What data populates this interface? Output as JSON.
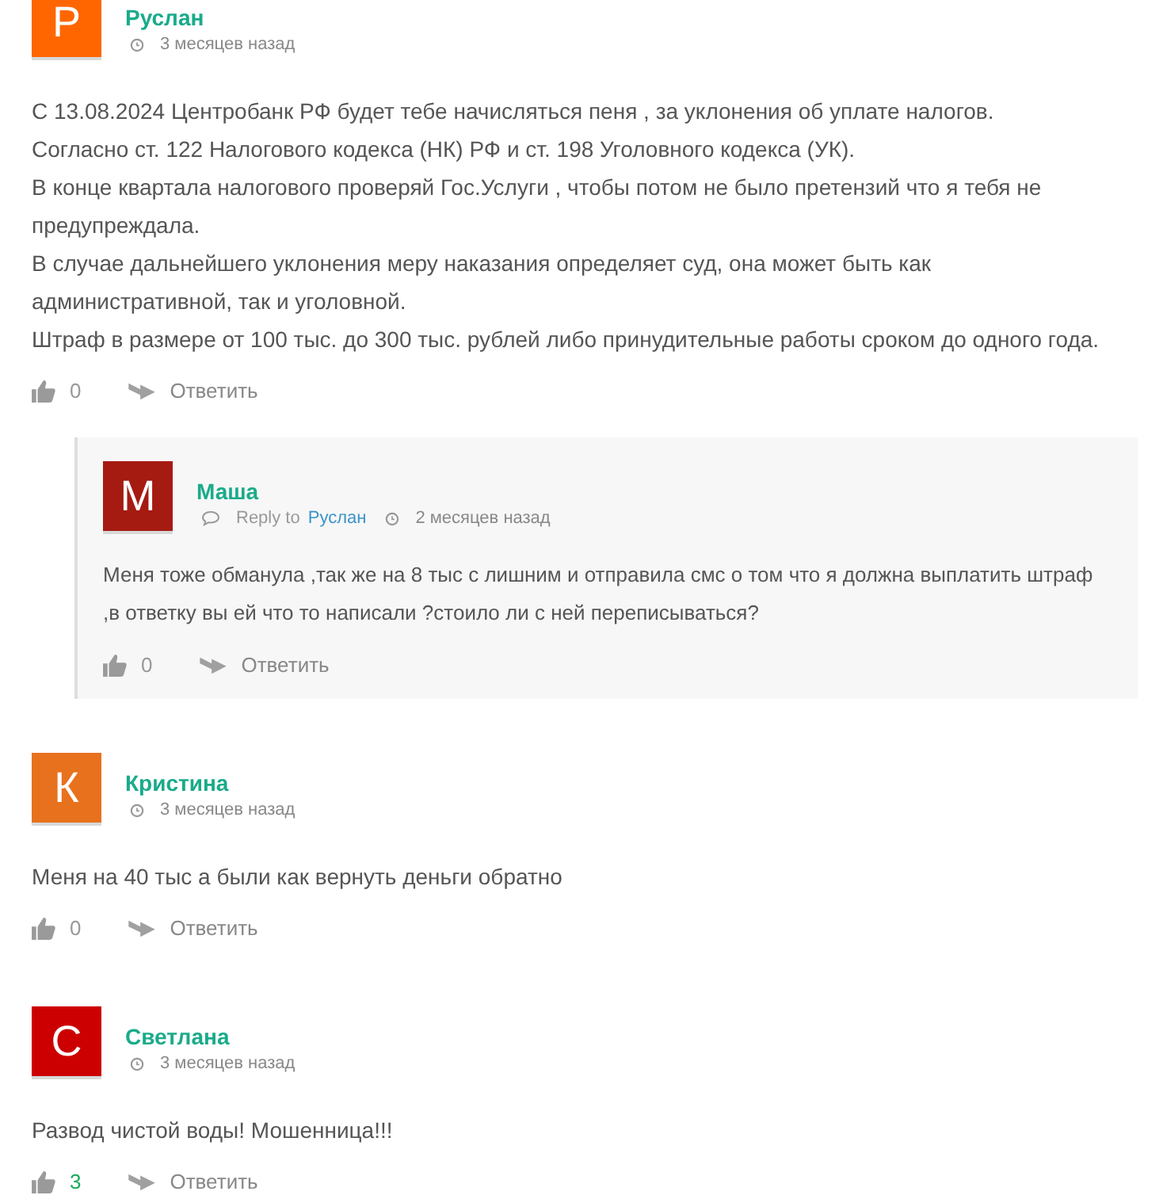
{
  "comments": [
    {
      "initial": "Р",
      "color": "#ff6600",
      "author": "Руслан",
      "time": "3 месяцев назад",
      "lines": [
        "С 13.08.2024 Центробанк РФ будет тебе начисляться пеня , за уклонения об уплате налогов.",
        "Согласно ст. 122 Налогового кодекса (НК) РФ и ст. 198 Уголовного кодекса (УК).",
        "В конце квартала налогового проверяй Гос.Услуги , чтобы потом не было претензий что я тебя не предупреждала.",
        "В случае дальнейшего уклонения меру наказания определяет суд, она может быть как административной, так и уголовной.",
        "Штраф в размере от 100 тыс. до 300 тыс. рублей либо принудительные работы сроком до одного года."
      ],
      "votes": "0",
      "votes_positive": false,
      "reply_label": "Ответить",
      "children": [
        {
          "initial": "М",
          "color": "#a51b12",
          "author": "Маша",
          "reply_prefix": "Reply to",
          "reply_to": "Руслан",
          "time": "2 месяцев назад",
          "lines": [
            "Меня тоже обманула ,так же на 8 тыс с лишним и отправила смс о том что я должна выплатить штраф ,в ответку вы ей что то написали ?стоило ли с ней переписываться?"
          ],
          "votes": "0",
          "votes_positive": false,
          "reply_label": "Ответить"
        }
      ]
    },
    {
      "initial": "К",
      "color": "#e8711d",
      "author": "Кристина",
      "time": "3 месяцев назад",
      "lines": [
        "Меня на 40 тыс а были как вернуть деньги обратно"
      ],
      "votes": "0",
      "votes_positive": false,
      "reply_label": "Ответить"
    },
    {
      "initial": "С",
      "color": "#cc0000",
      "author": "Светлана",
      "time": "3 месяцев назад",
      "lines": [
        "Развод чистой воды! Мошенница!!!"
      ],
      "votes": "3",
      "votes_positive": true,
      "reply_label": "Ответить"
    }
  ]
}
